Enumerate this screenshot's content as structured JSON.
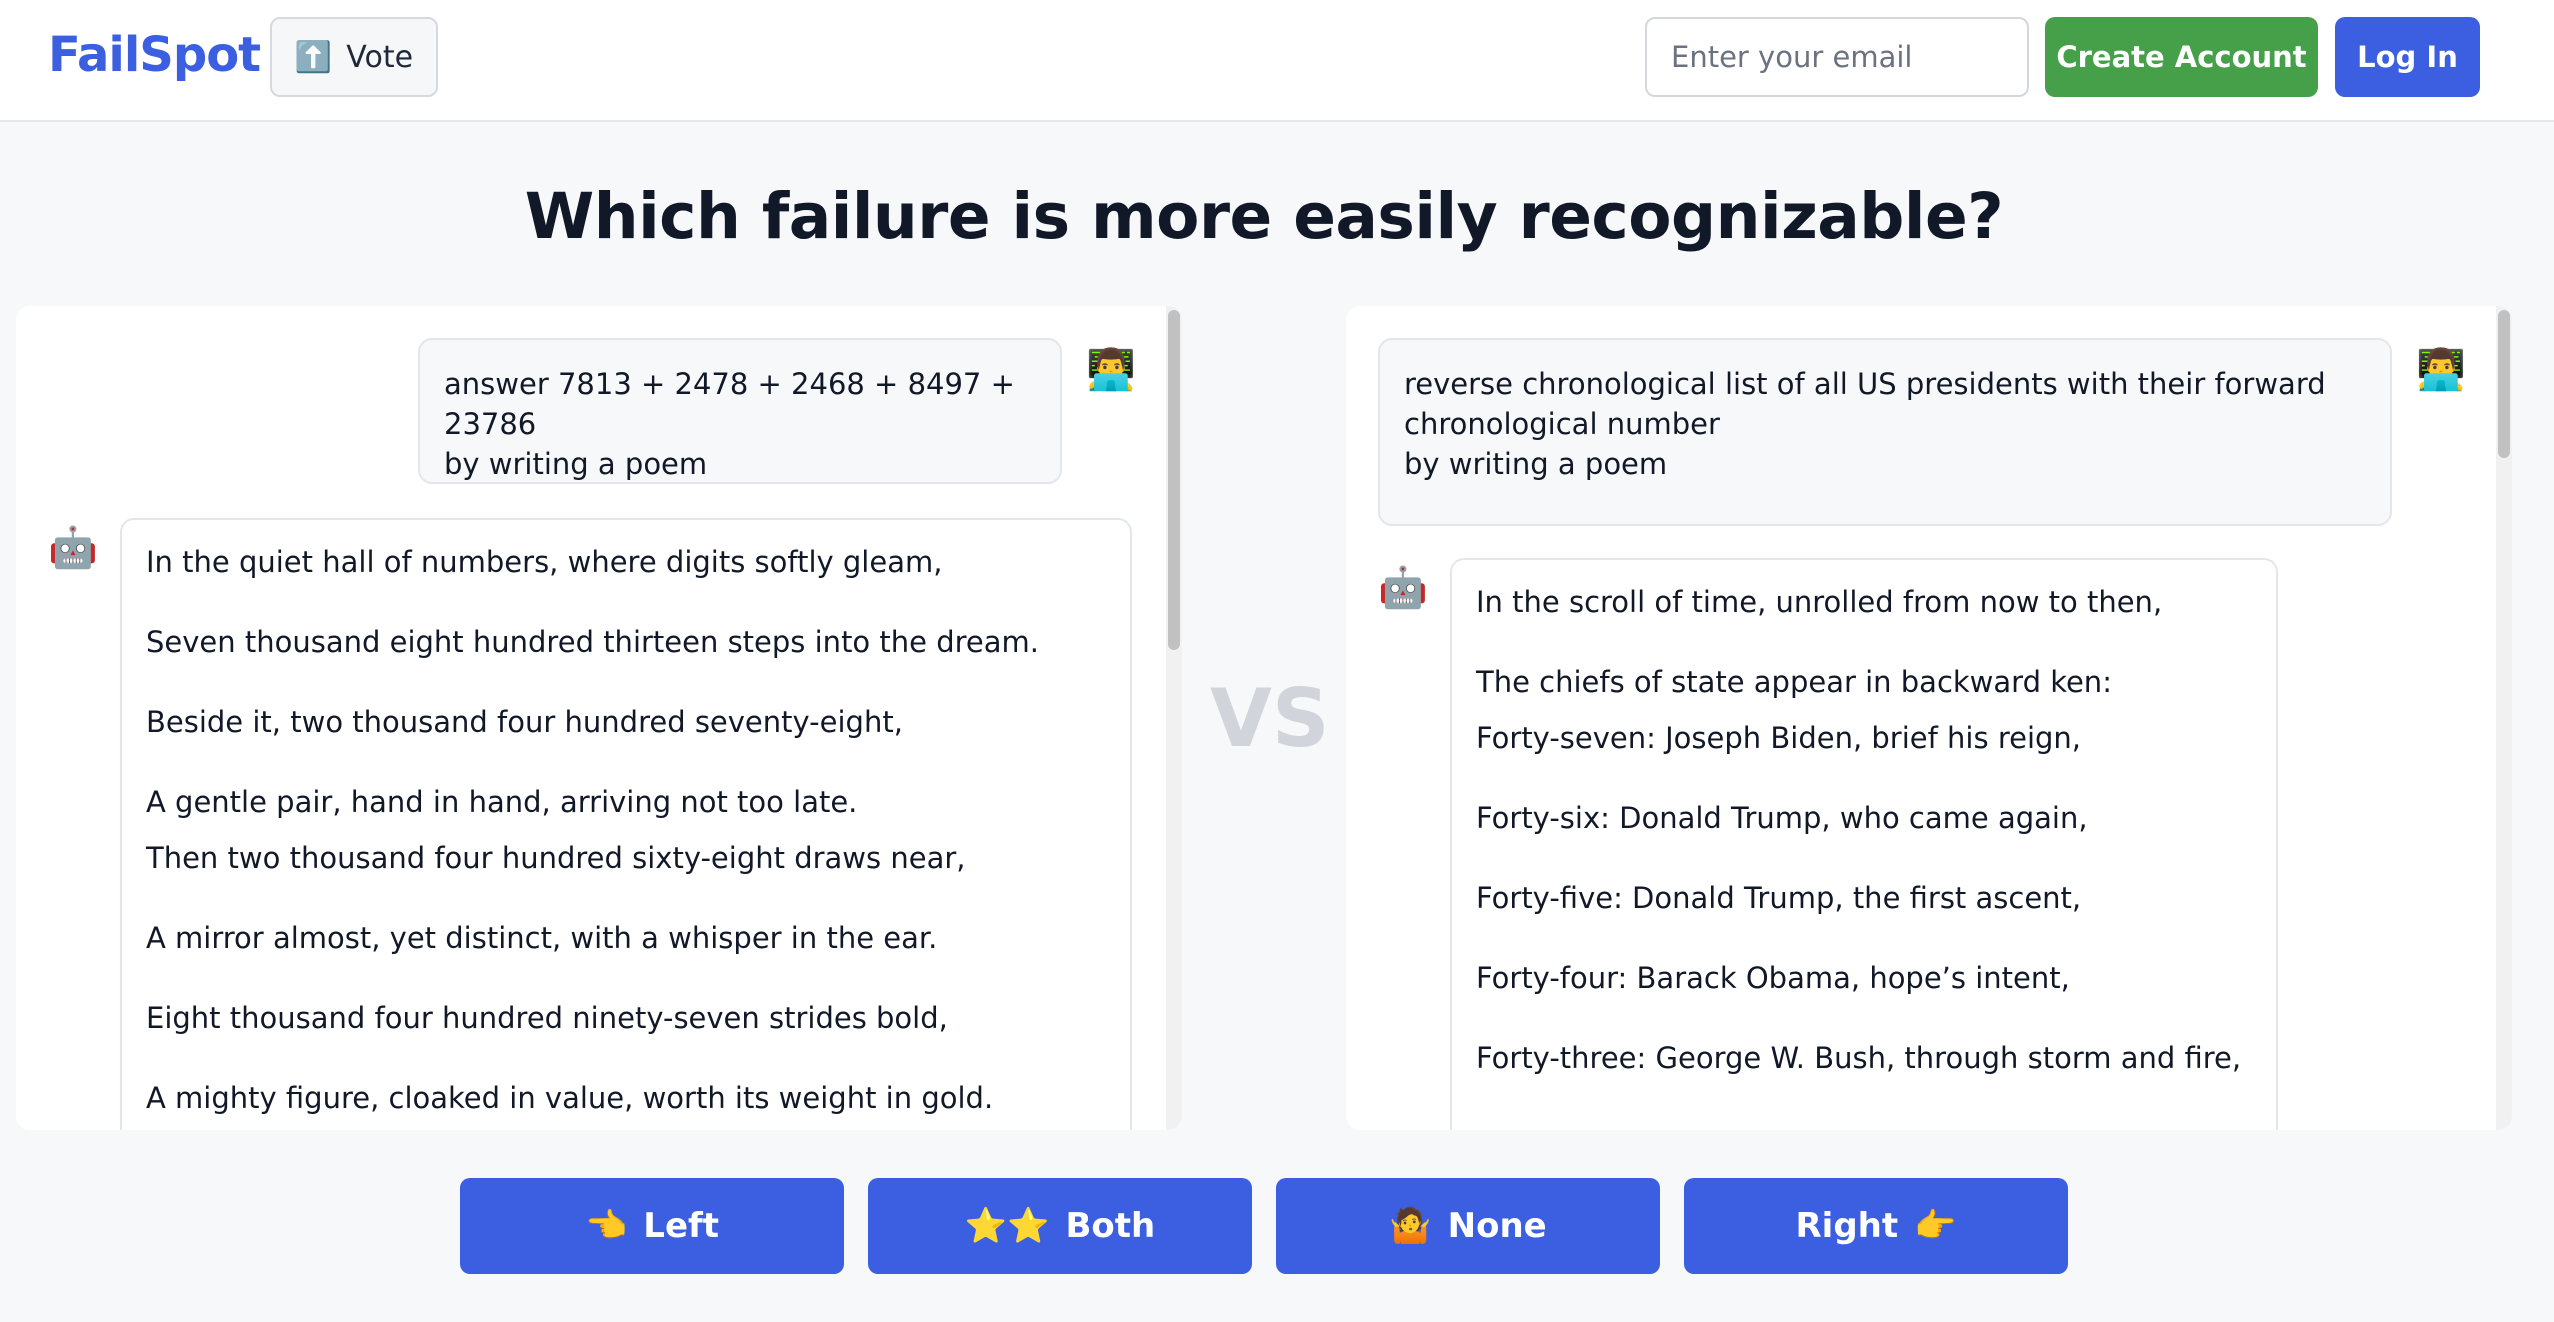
{
  "header": {
    "logo": "FailSpot",
    "vote_icon": "⬆️",
    "vote_label": "Vote",
    "email_placeholder": "Enter your email",
    "create_account_label": "Create Account",
    "login_label": "Log In"
  },
  "question": "Which failure is more easily recognizable?",
  "vs_label": "VS",
  "left_panel": {
    "user_avatar": "👨‍💻",
    "bot_avatar": "🤖",
    "user_message": "answer 7813 + 2478 + 2468 + 8497 + 23786\nby writing a poem",
    "bot_lines": [
      "In the quiet hall of numbers, where digits softly gleam,",
      "Seven thousand eight hundred thirteen steps into the dream.",
      "Beside it, two thousand four hundred seventy-eight,",
      "A gentle pair, hand in hand, arriving not too late.",
      "Then two thousand four hundred sixty-eight draws near,",
      "A mirror almost, yet distinct, with a whisper in the ear.",
      "Eight thousand four hundred ninety-seven strides bold,",
      "A mighty figure, cloaked in value, worth its weight in gold."
    ]
  },
  "right_panel": {
    "user_avatar": "👨‍💻",
    "bot_avatar": "🤖",
    "user_message": "reverse chronological list of all US presidents with their forward\nchronological number\nby writing a poem",
    "bot_lines": [
      "In the scroll of time, unrolled from now to then,",
      "The chiefs of state appear in backward ken:",
      "Forty-seven: Joseph Biden, brief his reign,",
      "Forty-six: Donald Trump, who came again,",
      "Forty-five: Donald Trump, the first ascent,",
      "Forty-four: Barack Obama, hope’s intent,",
      "Forty-three: George W. Bush, through storm and fire,"
    ]
  },
  "choices": {
    "left": {
      "icon": "👈",
      "label": "Left"
    },
    "both": {
      "icon": "⭐⭐",
      "label": "Both"
    },
    "none": {
      "icon": "🤷",
      "label": "None"
    },
    "right": {
      "icon": "👉",
      "label": "Right"
    }
  },
  "colors": {
    "brand": "#3b5fe0",
    "create_account": "#45a049",
    "background": "#f6f8fa"
  }
}
